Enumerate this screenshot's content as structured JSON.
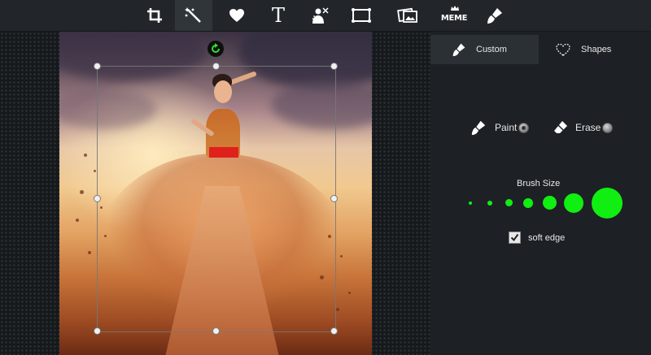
{
  "toolbar": {
    "tools": [
      {
        "icon": "crop-icon"
      },
      {
        "icon": "magic-wand-icon",
        "active": true
      },
      {
        "icon": "heart-icon"
      },
      {
        "icon": "text-icon",
        "glyph": "T"
      },
      {
        "icon": "person-effect-icon"
      },
      {
        "icon": "frame-icon"
      },
      {
        "icon": "photo-frame-icon"
      },
      {
        "icon": "meme-icon",
        "label": "MEME"
      },
      {
        "icon": "brush-icon"
      }
    ]
  },
  "panel": {
    "tabs": [
      {
        "label": "Custom",
        "icon": "brush-icon",
        "active": true
      },
      {
        "label": "Shapes",
        "icon": "heart-outline-icon",
        "active": false
      }
    ],
    "paint_label": "Paint",
    "erase_label": "Erase",
    "selected_mode": "Paint",
    "brush_size_label": "Brush Size",
    "brush_sizes_count": 7,
    "brush_color": "#11ee11",
    "soft_edge_label": "soft edge",
    "soft_edge_checked": true
  },
  "colors": {
    "toolbar_bg": "#22262a",
    "panel_bg": "#1d2125",
    "accent_green": "#11ee11"
  }
}
